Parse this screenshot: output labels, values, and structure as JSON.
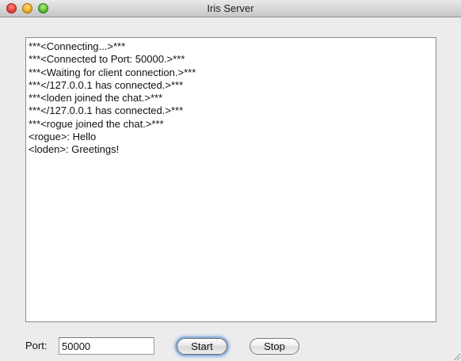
{
  "window": {
    "title": "Iris Server"
  },
  "log": {
    "lines": [
      "***<Connecting...>***",
      "***<Connected to Port: 50000.>***",
      "***<Waiting for client connection.>***",
      "***</127.0.0.1 has connected.>***",
      "***<loden joined the chat.>***",
      "***</127.0.0.1 has connected.>***",
      "***<rogue joined the chat.>***",
      "<rogue>: Hello",
      "<loden>: Greetings!"
    ]
  },
  "controls": {
    "port_label": "Port:",
    "port_value": "50000",
    "start_label": "Start",
    "stop_label": "Stop"
  }
}
